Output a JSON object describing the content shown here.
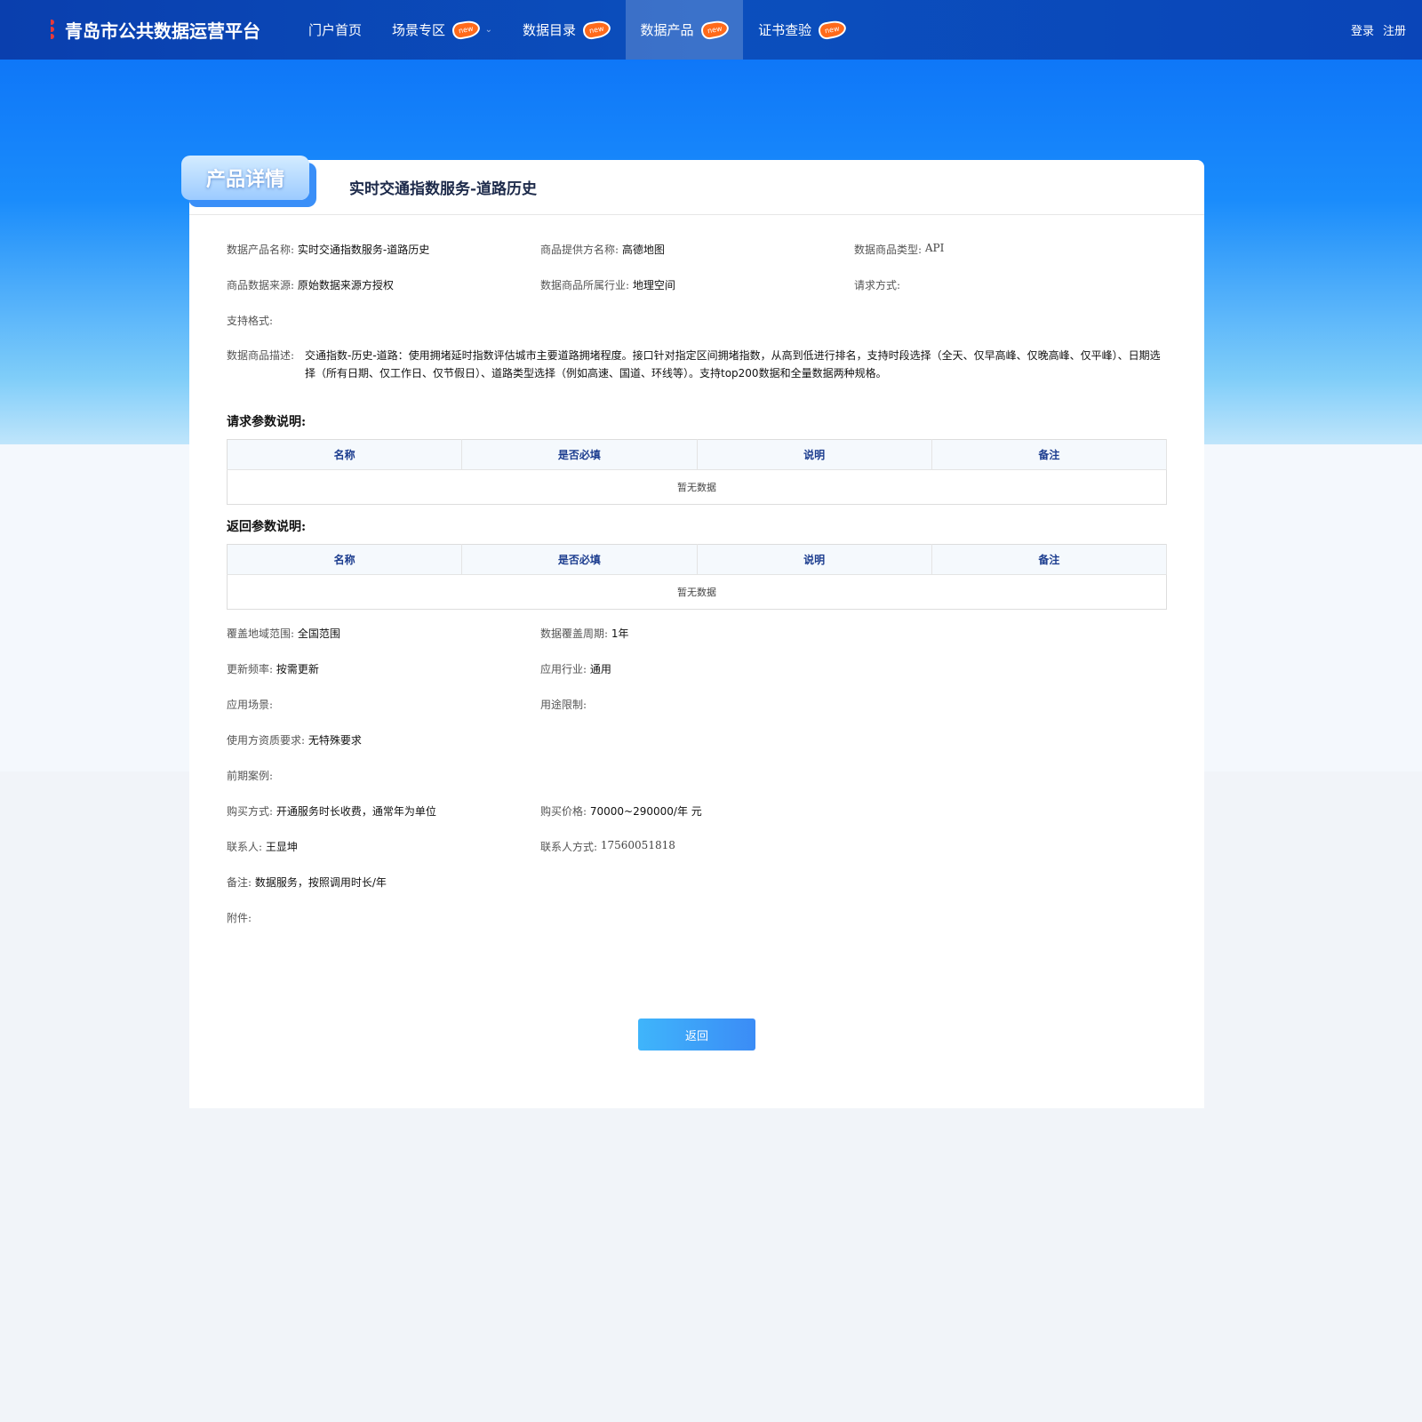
{
  "nav": {
    "brand": "青岛市公共数据运营平台",
    "items": [
      {
        "label": "门户首页",
        "new": false
      },
      {
        "label": "场景专区",
        "new": true,
        "dropdown": true
      },
      {
        "label": "数据目录",
        "new": true
      },
      {
        "label": "数据产品",
        "new": true,
        "active": true
      },
      {
        "label": "证书查验",
        "new": true
      }
    ],
    "new_badge": "new",
    "login": "登录",
    "register": "注册"
  },
  "badge": "产品详情",
  "title": "实时交通指数服务-道路历史",
  "fields": {
    "name": {
      "label": "数据产品名称:",
      "value": "实时交通指数服务-道路历史"
    },
    "provider": {
      "label": "商品提供方名称:",
      "value": "高德地图"
    },
    "type": {
      "label": "数据商品类型:",
      "value": "API"
    },
    "source": {
      "label": "商品数据来源:",
      "value": "原始数据来源方授权"
    },
    "industry": {
      "label": "数据商品所属行业:",
      "value": "地理空间"
    },
    "method": {
      "label": "请求方式:",
      "value": ""
    },
    "format": {
      "label": "支持格式:",
      "value": ""
    },
    "desc": {
      "label": "数据商品描述:",
      "value": "交通指数-历史-道路：使用拥堵延时指数评估城市主要道路拥堵程度。接口针对指定区间拥堵指数，从高到低进行排名，支持时段选择（全天、仅早高峰、仅晚高峰、仅平峰）、日期选择（所有日期、仅工作日、仅节假日）、道路类型选择（例如高速、国道、环线等）。支持top200数据和全量数据两种规格。"
    },
    "region": {
      "label": "覆盖地域范围:",
      "value": "全国范围"
    },
    "period": {
      "label": "数据覆盖周期:",
      "value": "1年"
    },
    "freq": {
      "label": "更新频率:",
      "value": "按需更新"
    },
    "app_industry": {
      "label": "应用行业:",
      "value": "通用"
    },
    "scene": {
      "label": "应用场景:",
      "value": ""
    },
    "limit": {
      "label": "用途限制:",
      "value": ""
    },
    "qual": {
      "label": "使用方资质要求:",
      "value": "无特殊要求"
    },
    "cases": {
      "label": "前期案例:",
      "value": ""
    },
    "buy": {
      "label": "购买方式:",
      "value": "开通服务时长收费，通常年为单位"
    },
    "price": {
      "label": "购买价格:",
      "value": "70000~290000/年 元"
    },
    "contact": {
      "label": "联系人:",
      "value": "王显坤"
    },
    "phone": {
      "label": "联系人方式:",
      "value": "17560051818"
    },
    "note": {
      "label": "备注:",
      "value": "数据服务，按照调用时长/年"
    },
    "attach": {
      "label": "附件:",
      "value": ""
    }
  },
  "req_title": "请求参数说明:",
  "resp_title": "返回参数说明:",
  "columns": [
    "名称",
    "是否必填",
    "说明",
    "备注"
  ],
  "empty": "暂无数据",
  "back": "返回"
}
